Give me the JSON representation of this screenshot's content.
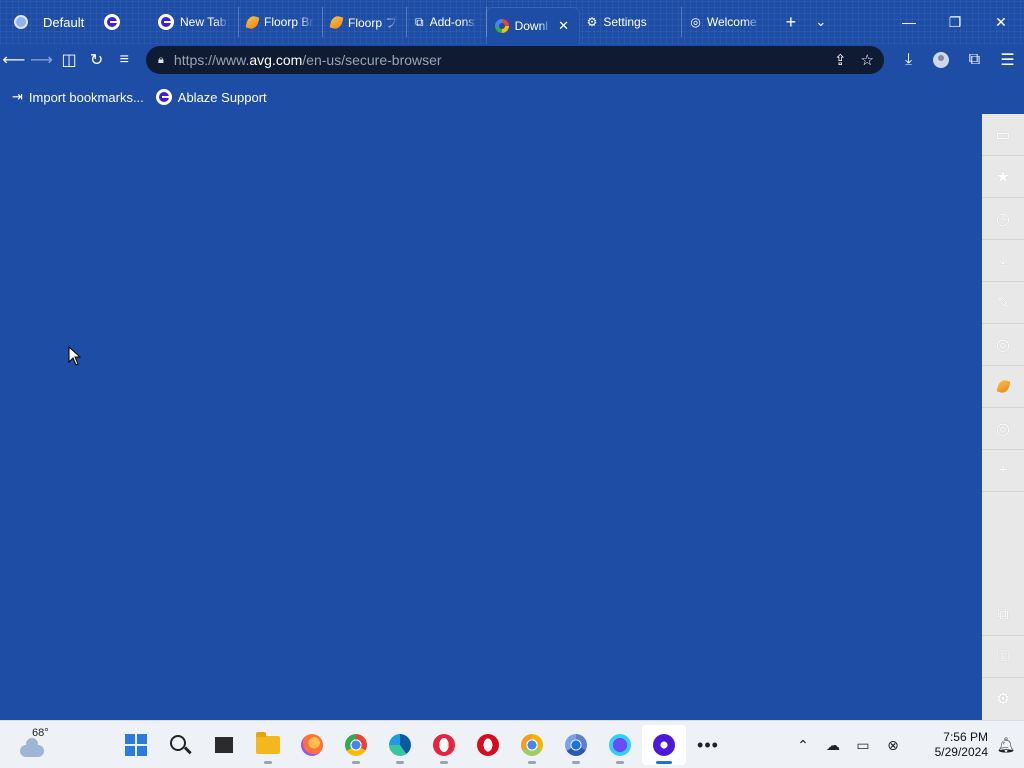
{
  "profile": {
    "label": "Default"
  },
  "tabs": [
    {
      "label": "New Tab",
      "icon": "ablaze-icon",
      "active": false
    },
    {
      "label": "Floorp Br",
      "icon": "floorp-leaf-icon",
      "active": false
    },
    {
      "label": "Floorp ブ",
      "icon": "floorp-leaf-icon",
      "active": false
    },
    {
      "label": "Add-ons",
      "icon": "puzzle-icon",
      "active": false
    },
    {
      "label": "Downl",
      "icon": "google-icon",
      "active": true
    },
    {
      "label": "Settings",
      "icon": "gear-icon",
      "active": false
    },
    {
      "label": "Welcome",
      "icon": "globe-icon",
      "active": false
    }
  ],
  "address_bar": {
    "url_prefix": "https://www.",
    "url_host": "avg.com",
    "url_path": "/en-us/secure-browser"
  },
  "bookmarks": [
    {
      "label": "Import bookmarks...",
      "icon": "import-icon"
    },
    {
      "label": "Ablaze Support",
      "icon": "ablaze-icon"
    }
  ],
  "sidebar": {
    "items": [
      "briefcase-icon",
      "star-icon",
      "history-icon",
      "download-icon",
      "pencil-icon",
      "globe-icon",
      "floorp-leaf-icon",
      "globe-icon",
      "plus-icon"
    ],
    "bottom_items": [
      "extension-icon",
      "key-icon",
      "gear-icon"
    ]
  },
  "taskbar": {
    "weather_temp": "68°",
    "time": "7:56 PM",
    "date": "5/29/2024",
    "apps": [
      "start",
      "search",
      "task-view",
      "file-explorer",
      "firefox",
      "chrome",
      "edge",
      "opera",
      "opera-gx",
      "chrome-canary",
      "chromium",
      "floorp",
      "ablaze"
    ]
  },
  "colors": {
    "theme_blue": "#1e4da6",
    "urlbar_bg": "#0f1b33",
    "sidebar_bg": "#e8e8e8",
    "taskbar_bg": "#eef1f6"
  }
}
